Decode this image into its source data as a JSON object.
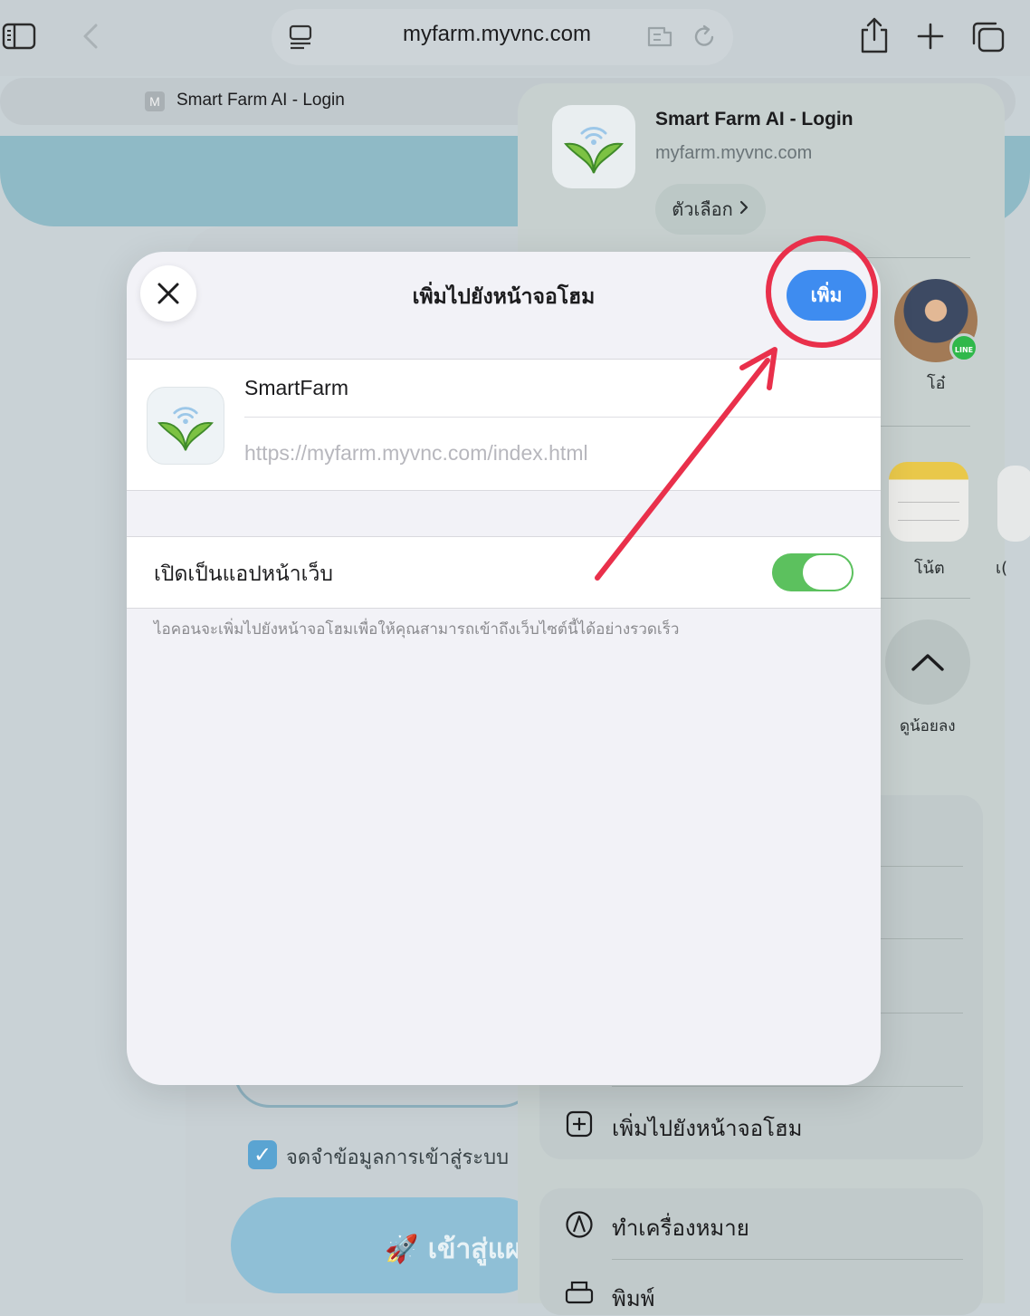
{
  "browser": {
    "url": "myfarm.myvnc.com",
    "tab_favicon_letter": "M",
    "tab_title": "Smart Farm AI - Login",
    "icons": [
      "sidebar-icon",
      "back-icon",
      "reader-icon",
      "extension-icon",
      "reload-icon",
      "share-icon",
      "plus-icon",
      "tabs-icon"
    ]
  },
  "background_page": {
    "remember_label": "จดจำข้อมูลการเข้าสู่ระบบ",
    "login_label": "🚀 เข้าสู่แผ"
  },
  "share_sheet": {
    "page_title": "Smart Farm AI - Login",
    "page_url": "myfarm.myvnc.com",
    "options_label": "ตัวเลือก",
    "contact_name": "โอ๋",
    "contact_badge": "LINE",
    "app_notes_label": "โน้ต",
    "app_partial_label": "เ(",
    "more_label": "ดูน้อยลง",
    "actions": [
      {
        "label": "เพิ่มไปยังหน้าจอโฮม",
        "icon": "add-square-icon"
      },
      {
        "label": "ทำเครื่องหมาย",
        "icon": "markup-icon"
      },
      {
        "label": "พิมพ์",
        "icon": "printer-icon"
      }
    ]
  },
  "modal": {
    "title": "เพิ่มไปยังหน้าจอโฮม",
    "add_label": "เพิ่ม",
    "app_name": "SmartFarm",
    "app_url": "https://myfarm.myvnc.com/index.html",
    "webapp_toggle_label": "เปิดเป็นแอปหน้าเว็บ",
    "webapp_toggle_on": true,
    "footnote": "ไอคอนจะเพิ่มไปยังหน้าจอโฮมเพื่อให้คุณสามารถเข้าถึงเว็บไซต์นี้ได้อย่างรวดเร็ว"
  },
  "colors": {
    "accent_blue": "#3e8cf0",
    "toggle_green": "#5cc15e",
    "annotation_red": "#e9304b"
  }
}
